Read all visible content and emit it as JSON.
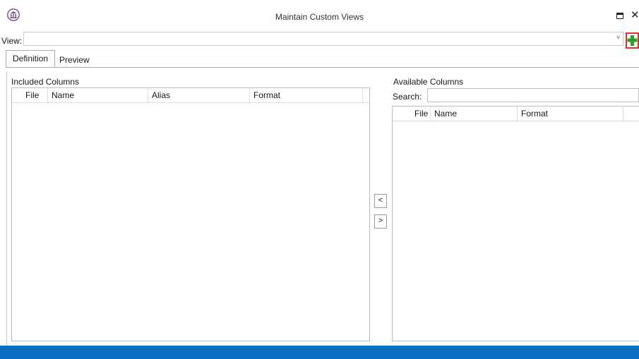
{
  "window": {
    "title": "Maintain Custom Views",
    "icon": "columned-building-icon",
    "maximize_icon": "maximize-icon",
    "close_glyph": "✕"
  },
  "view_row": {
    "label": "View:",
    "value": "",
    "dropdown_glyph": "˅",
    "add_icon": "green-plus-icon",
    "highlight_color": "#e0312e",
    "add_color": "#2ca02c"
  },
  "tabs": [
    {
      "label": "Definition",
      "selected": true
    },
    {
      "label": "Preview",
      "selected": false
    }
  ],
  "included": {
    "label": "Included Columns",
    "columns": [
      "File",
      "Name",
      "Alias",
      "Format"
    ],
    "rows": []
  },
  "available": {
    "label": "Available Columns",
    "search_label": "Search:",
    "search_value": "",
    "columns": [
      "File",
      "Name",
      "Format"
    ],
    "rows": []
  },
  "move_buttons": {
    "left": "<",
    "right": ">"
  },
  "statusbar_color": "#0a6fc2"
}
